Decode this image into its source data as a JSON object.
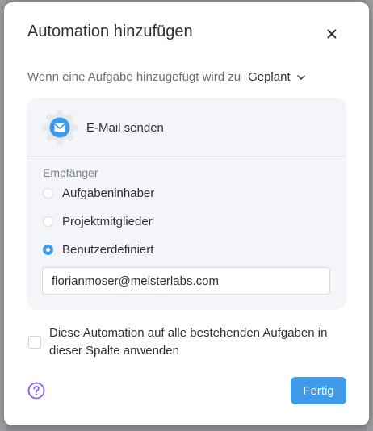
{
  "modal": {
    "title": "Automation hinzufügen",
    "close_icon": "close-icon"
  },
  "trigger": {
    "text": "Wenn eine Aufgabe hinzugefügt wird zu",
    "selected_column": "Geplant",
    "chevron_icon": "chevron-down-icon"
  },
  "action": {
    "icon": "mail-gear-icon",
    "title": "E-Mail senden",
    "recipients_label": "Empfänger",
    "options": [
      {
        "label": "Aufgabeninhaber",
        "selected": false
      },
      {
        "label": "Projektmitglieder",
        "selected": false
      },
      {
        "label": "Benutzerdefiniert",
        "selected": true
      }
    ],
    "custom_email": "florianmoser@meisterlabs.com"
  },
  "apply_existing": {
    "checked": false,
    "label": "Diese Automation auf alle bestehenden Aufgaben in dieser Spalte anwenden"
  },
  "footer": {
    "help_icon": "help-icon",
    "done_label": "Fertig"
  },
  "colors": {
    "accent": "#3d9be9",
    "help_purple": "#8b5cf6",
    "card_background": "#f3f5f8"
  }
}
